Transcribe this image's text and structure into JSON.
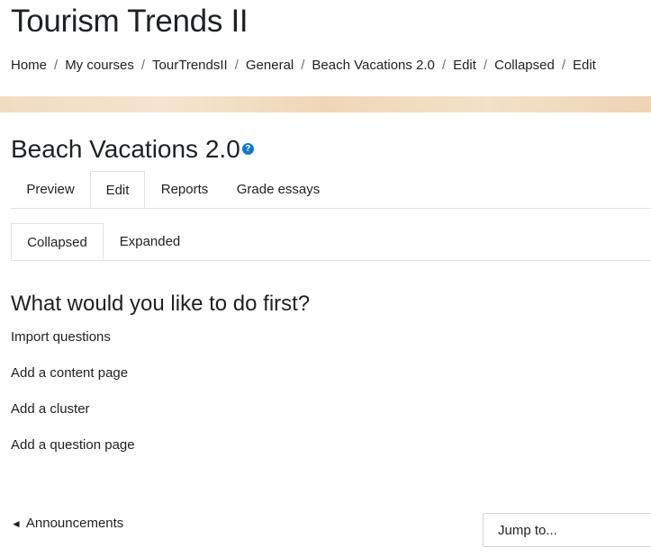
{
  "course": {
    "title": "Tourism Trends II"
  },
  "breadcrumb": [
    "Home",
    "My courses",
    "TourTrendsII",
    "General",
    "Beach Vacations 2.0",
    "Edit",
    "Collapsed",
    "Edit"
  ],
  "breadcrumb_separator": "/",
  "activity": {
    "title": "Beach Vacations 2.0",
    "help_icon": "?"
  },
  "main_tabs": [
    "Preview",
    "Edit",
    "Reports",
    "Grade essays"
  ],
  "main_tabs_active": "Edit",
  "sub_tabs": [
    "Collapsed",
    "Expanded"
  ],
  "sub_tabs_active": "Collapsed",
  "prompt": {
    "heading": "What would you like to do first?"
  },
  "actions": [
    "Import questions",
    "Add a content page",
    "Add a cluster",
    "Add a question page"
  ],
  "nav": {
    "previous_icon": "◄",
    "previous_label": "Announcements",
    "jump_label": "Jump to..."
  },
  "colors": {
    "accent": "#1177d1",
    "border": "#dee2e6"
  }
}
